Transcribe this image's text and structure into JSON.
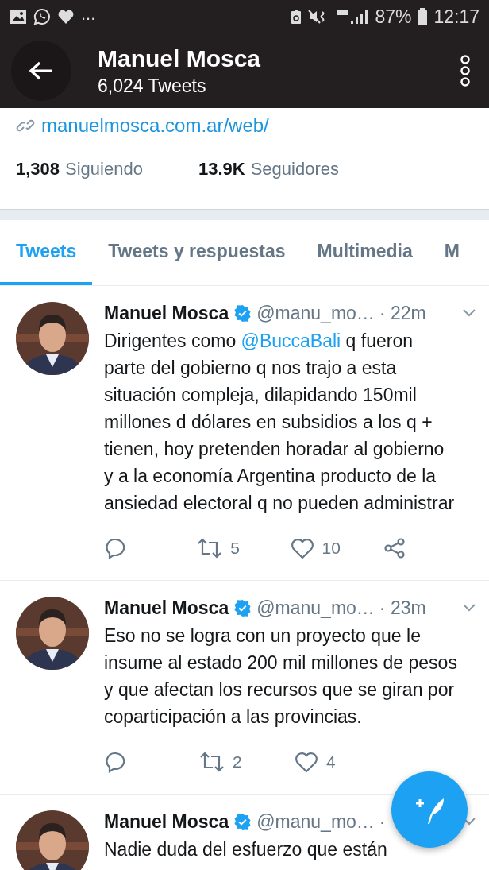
{
  "status_bar": {
    "notifications": "...",
    "battery": "87%",
    "time": "12:17"
  },
  "header": {
    "title": "Manuel Mosca",
    "subtitle": "6,024 Tweets"
  },
  "profile": {
    "link": "manuelmosca.com.ar/web/",
    "stats": [
      {
        "count": "1,308",
        "label": "Siguiendo"
      },
      {
        "count": "13.9K",
        "label": "Seguidores"
      }
    ]
  },
  "tabs": [
    {
      "label": "Tweets",
      "selected": true
    },
    {
      "label": "Tweets y respuestas",
      "selected": false
    },
    {
      "label": "Multimedia",
      "selected": false
    },
    {
      "label": "M",
      "selected": false
    }
  ],
  "tweets": [
    {
      "name": "Manuel Mosca",
      "verified": true,
      "handle": "@manu_mo…",
      "time": "· 22m",
      "segments": [
        {
          "kind": "plain",
          "text": "Dirigentes como "
        },
        {
          "kind": "mention",
          "text": "@BuccaBali"
        },
        {
          "kind": "plain",
          "text": " q fueron parte del gobierno q nos trajo a esta situación compleja, dilapidando 150mil millones d dólares en subsidios a los q + tienen, hoy pretenden horadar al gobierno y a la economía Argentina producto de la ansiedad electoral q no pueden administrar"
        }
      ],
      "actions": [
        {
          "kind": "reply"
        },
        {
          "kind": "retweet",
          "count": "5"
        },
        {
          "kind": "like",
          "count": "10"
        },
        {
          "kind": "share"
        }
      ]
    },
    {
      "name": "Manuel Mosca",
      "verified": true,
      "handle": "@manu_mo…",
      "time": "· 23m",
      "segments": [
        {
          "kind": "plain",
          "text": "Eso no se logra con un proyecto que le insume al estado 200 mil millones de pesos y que afectan los recursos que se giran por coparticipación a las provincias."
        }
      ],
      "actions": [
        {
          "kind": "reply"
        },
        {
          "kind": "retweet",
          "count": "2"
        },
        {
          "kind": "like",
          "count": "4"
        }
      ]
    },
    {
      "name": "Manuel Mosca",
      "verified": true,
      "handle": "@manu_mo…",
      "time": "·",
      "segments": [
        {
          "kind": "plain",
          "text": "Nadie duda del esfuerzo que están"
        }
      ]
    }
  ]
}
